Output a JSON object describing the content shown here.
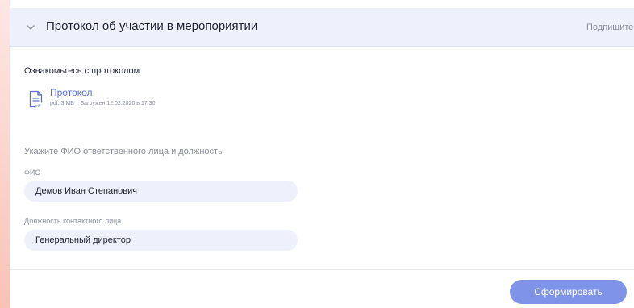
{
  "header": {
    "title": "Протокол об участии в меропориятии",
    "right_label": "Подпишите",
    "chevron_icon": "chevron-down-icon"
  },
  "protocol": {
    "section_title": "Ознакомьтесь с протоколом",
    "file_icon": "pdf-file-icon",
    "file_name": "Протокол",
    "file_info": "pdf, 3 МБ",
    "uploaded": "Загружен 12.02.2020 в 17:30"
  },
  "form": {
    "prompt": "Укажите ФИО ответственного лица и должность",
    "fio_label": "ФИО",
    "fio_value": "Демов Иван Степанович",
    "position_label": "Должность контактного лица",
    "position_value": "Генеральный директор"
  },
  "footer": {
    "submit_label": "Сформировать"
  },
  "colors": {
    "accent": "#7f93e8",
    "link": "#5a70d8",
    "header_bg": "#eef0fb",
    "field_bg": "#eef0fb"
  }
}
